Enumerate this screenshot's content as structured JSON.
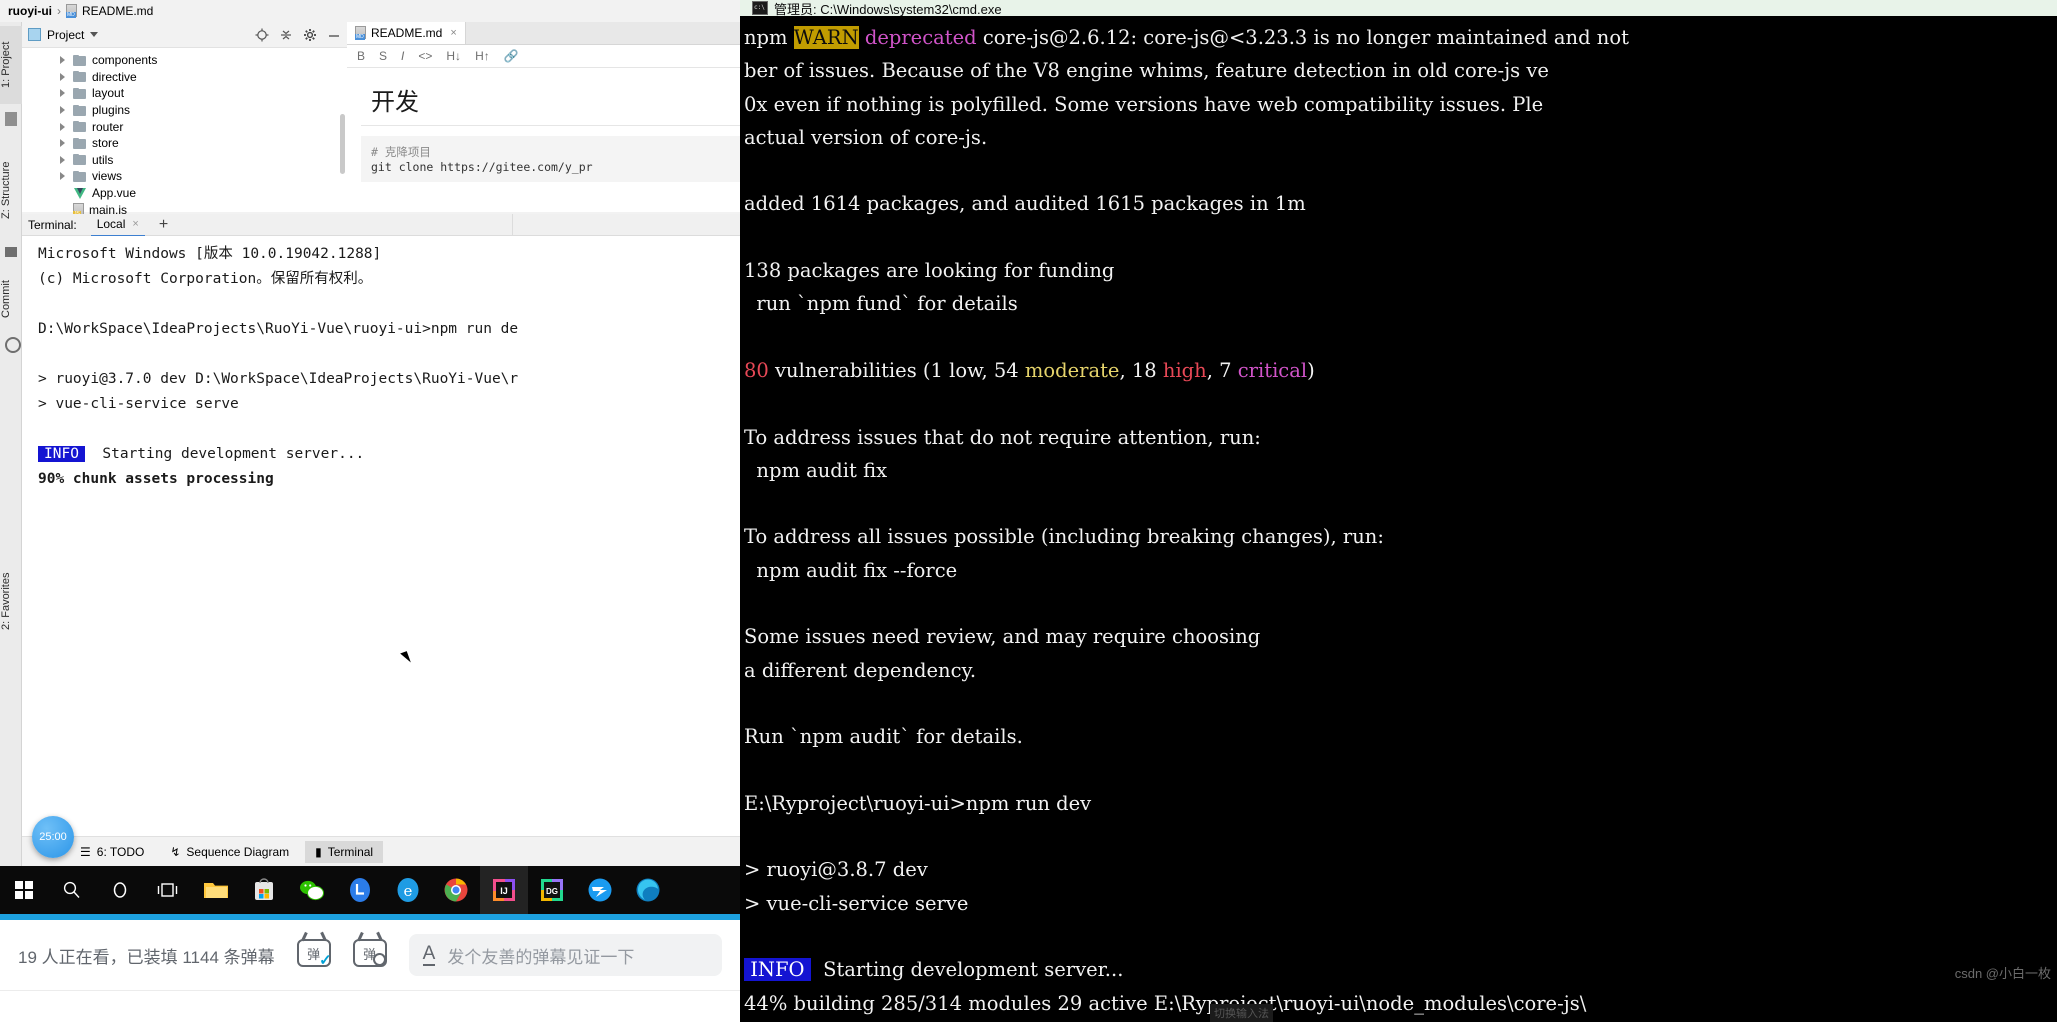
{
  "ide": {
    "breadcrumb": {
      "project": "ruoyi-ui",
      "separator": "›",
      "file": "README.md",
      "file_icon": "markdown-file-icon"
    },
    "left_strip": [
      {
        "label": "1: Project",
        "icon": "project-icon"
      },
      {
        "label": "Z: Structure",
        "icon": "structure-icon"
      },
      {
        "label": "Commit",
        "icon": "commit-icon"
      },
      {
        "label": "2: Favorites",
        "icon": "favorites-icon"
      }
    ],
    "project_panel": {
      "title": "Project",
      "icons": [
        "target-icon",
        "collapse-all-icon",
        "gear-icon",
        "minimize-icon"
      ],
      "tree": [
        {
          "label": "components",
          "type": "folder"
        },
        {
          "label": "directive",
          "type": "folder"
        },
        {
          "label": "layout",
          "type": "folder"
        },
        {
          "label": "plugins",
          "type": "folder"
        },
        {
          "label": "router",
          "type": "folder"
        },
        {
          "label": "store",
          "type": "folder"
        },
        {
          "label": "utils",
          "type": "folder"
        },
        {
          "label": "views",
          "type": "folder"
        },
        {
          "label": "App.vue",
          "type": "vue"
        },
        {
          "label": "main.js",
          "type": "js"
        }
      ]
    },
    "editor": {
      "tab": "README.md",
      "tab_close": "×",
      "toolbar": [
        "B",
        "S",
        "I",
        "<>",
        "H↓",
        "H↑",
        "link-icon"
      ],
      "heading": "开发",
      "code_comment": "# 克降项目",
      "code_line": "git clone https://gitee.com/y_pr"
    },
    "terminal_window": {
      "label": "Terminal:",
      "tab": "Local",
      "tab_close": "×",
      "add": "+",
      "lines": [
        "Microsoft Windows [版本 10.0.19042.1288]",
        "(c) Microsoft Corporation。保留所有权利。",
        "",
        "D:\\WorkSpace\\IdeaProjects\\RuoYi-Vue\\ruoyi-ui>npm run de",
        "",
        "> ruoyi@3.7.0 dev D:\\WorkSpace\\IdeaProjects\\RuoYi-Vue\\r",
        "> vue-cli-service serve",
        ""
      ],
      "info_badge": "INFO",
      "info_text": "Starting development server...",
      "progress_line": "90% chunk assets processing"
    },
    "bottom_bar": [
      {
        "label": "6: TODO",
        "icon": "todo-icon",
        "active": false
      },
      {
        "label": "Sequence Diagram",
        "icon": "sequence-diagram-icon",
        "active": false
      },
      {
        "label": "Terminal",
        "icon": "terminal-icon",
        "active": true
      }
    ],
    "timer": "25:00"
  },
  "taskbar": {
    "items": [
      {
        "name": "start-button",
        "glyph": "⊞",
        "color": "#ffffff"
      },
      {
        "name": "search-icon",
        "glyph": "⚲",
        "color": "#ffffff"
      },
      {
        "name": "cortana-icon",
        "glyph": "◯",
        "color": "#ffffff"
      },
      {
        "name": "task-view-icon",
        "glyph": "⌸",
        "color": "#ffffff"
      },
      {
        "name": "file-explorer-icon",
        "glyph": "🗀",
        "color": "#ffc83d"
      },
      {
        "name": "microsoft-store-icon",
        "glyph": "🛍",
        "color": "#dddddd"
      },
      {
        "name": "wechat-icon",
        "glyph": "💬",
        "color": "#2dc100"
      },
      {
        "name": "lark-icon",
        "glyph": "L",
        "color": "#2b7ce9"
      },
      {
        "name": "edge-legacy-icon",
        "glyph": "e",
        "color": "#1f9ce4"
      },
      {
        "name": "chrome-icon",
        "glyph": "◉",
        "color": "#e8453c"
      },
      {
        "name": "intellij-idea-icon",
        "glyph": "IJ",
        "color": "#f24e8c"
      },
      {
        "name": "datagrip-icon",
        "glyph": "DG",
        "color": "#22d88f"
      },
      {
        "name": "xunlei-icon",
        "glyph": "➤",
        "color": "#1a9bf0"
      },
      {
        "name": "edge-icon",
        "glyph": "◔",
        "color": "#1a9bd7"
      }
    ]
  },
  "cmd": {
    "title": "管理员: C:\\Windows\\system32\\cmd.exe",
    "lines": [
      {
        "segments": [
          {
            "t": "npm ",
            "c": "white"
          },
          {
            "t": "WARN",
            "c": "warn"
          },
          {
            "t": " ",
            "c": "white"
          },
          {
            "t": "deprecated",
            "c": "magenta"
          },
          {
            "t": " core-js@2.6.12: core-js@<3.23.3 is no longer maintained and not",
            "c": "white"
          }
        ]
      },
      {
        "segments": [
          {
            "t": "ber of issues. Because of the V8 engine whims, feature detection in old core-js ve",
            "c": "white"
          }
        ]
      },
      {
        "segments": [
          {
            "t": "0x even if nothing is polyfilled. Some versions have web compatibility issues. Ple",
            "c": "white"
          }
        ]
      },
      {
        "segments": [
          {
            "t": "actual version of core-js.",
            "c": "white"
          }
        ]
      },
      {
        "segments": [
          {
            "t": "",
            "c": "white"
          }
        ]
      },
      {
        "segments": [
          {
            "t": "added 1614 packages, and audited 1615 packages in 1m",
            "c": "white"
          }
        ]
      },
      {
        "segments": [
          {
            "t": "",
            "c": "white"
          }
        ]
      },
      {
        "segments": [
          {
            "t": "138 packages are looking for funding",
            "c": "white"
          }
        ]
      },
      {
        "segments": [
          {
            "t": "  run `npm fund` for details",
            "c": "white"
          }
        ]
      },
      {
        "segments": [
          {
            "t": "",
            "c": "white"
          }
        ]
      },
      {
        "segments": [
          {
            "t": "80",
            "c": "red"
          },
          {
            "t": " vulnerabilities (1 ",
            "c": "white"
          },
          {
            "t": "low",
            "c": "white"
          },
          {
            "t": ", 54 ",
            "c": "white"
          },
          {
            "t": "moderate",
            "c": "yellow"
          },
          {
            "t": ", 18 ",
            "c": "white"
          },
          {
            "t": "high",
            "c": "red"
          },
          {
            "t": ", 7 ",
            "c": "white"
          },
          {
            "t": "critical",
            "c": "crit"
          },
          {
            "t": ")",
            "c": "white"
          }
        ]
      },
      {
        "segments": [
          {
            "t": "",
            "c": "white"
          }
        ]
      },
      {
        "segments": [
          {
            "t": "To address issues that do not require attention, run:",
            "c": "white"
          }
        ]
      },
      {
        "segments": [
          {
            "t": "  npm audit fix",
            "c": "white"
          }
        ]
      },
      {
        "segments": [
          {
            "t": "",
            "c": "white"
          }
        ]
      },
      {
        "segments": [
          {
            "t": "To address all issues possible (including breaking changes), run:",
            "c": "white"
          }
        ]
      },
      {
        "segments": [
          {
            "t": "  npm audit fix --force",
            "c": "white"
          }
        ]
      },
      {
        "segments": [
          {
            "t": "",
            "c": "white"
          }
        ]
      },
      {
        "segments": [
          {
            "t": "Some issues need review, and may require choosing",
            "c": "white"
          }
        ]
      },
      {
        "segments": [
          {
            "t": "a different dependency.",
            "c": "white"
          }
        ]
      },
      {
        "segments": [
          {
            "t": "",
            "c": "white"
          }
        ]
      },
      {
        "segments": [
          {
            "t": "Run `npm audit` for details.",
            "c": "white"
          }
        ]
      },
      {
        "segments": [
          {
            "t": "",
            "c": "white"
          }
        ]
      },
      {
        "segments": [
          {
            "t": "E:\\Ryproject\\ruoyi-ui>npm run dev",
            "c": "white"
          }
        ]
      },
      {
        "segments": [
          {
            "t": "",
            "c": "white"
          }
        ]
      },
      {
        "segments": [
          {
            "t": "> ruoyi@3.8.7 dev",
            "c": "white"
          }
        ]
      },
      {
        "segments": [
          {
            "t": "> vue-cli-service serve",
            "c": "white"
          }
        ]
      },
      {
        "segments": [
          {
            "t": "",
            "c": "white"
          }
        ]
      },
      {
        "segments": [
          {
            "t": " INFO ",
            "c": "info"
          },
          {
            "t": "  Starting development server...",
            "c": "white"
          }
        ]
      },
      {
        "segments": [
          {
            "t": "44% building 285/314 modules 29 active E:\\Ryproject\\ruoyi-ui\\node_modules\\core-js\\",
            "c": "white"
          }
        ]
      }
    ],
    "watermark": "csdn @小白一枚",
    "watermark2": "切换输入法"
  },
  "bilibili": {
    "viewers_text": "19 人正在看，已装填 1144 条弹幕",
    "danmaku_on_icon": "danmaku-toggle-icon",
    "danmaku_setting_icon": "danmaku-setting-icon",
    "font_icon": "A",
    "input_placeholder": "发个友善的弹幕见证一下"
  }
}
